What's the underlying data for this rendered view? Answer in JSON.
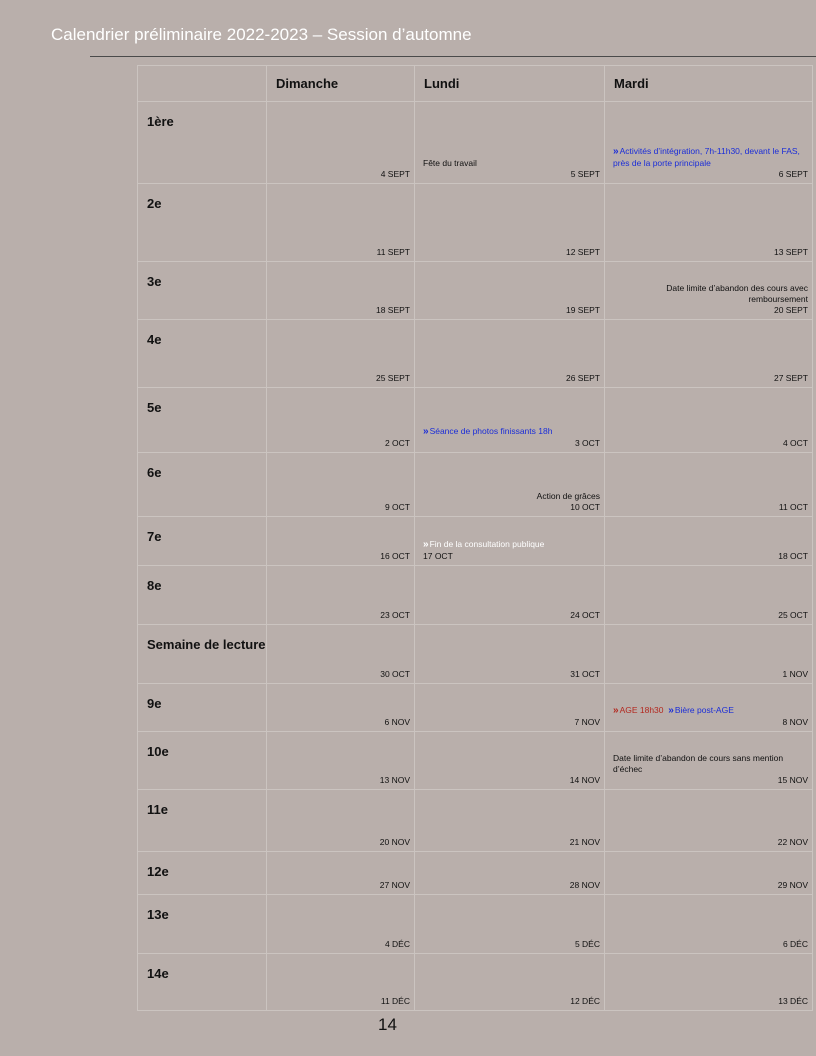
{
  "title": "Calendrier préliminaire 2022-2023 – Session d’automne",
  "headers": {
    "week": "",
    "sunday": "Dimanche",
    "monday": "Lundi",
    "tuesday": "Mardi"
  },
  "colors": {
    "background": "#b9afab",
    "blue": "#1a2dd8",
    "red": "#b3281f",
    "white": "#ffffff"
  },
  "arrow_icon": "»",
  "rows": [
    {
      "week": "1ère",
      "sun": "4 SEPT",
      "mon": "5 SEPT",
      "mon_note": "Fête du travail",
      "tue": "6 SEPT",
      "tue_note": "Activités d’intégration, 7h-11h30, devant le FAS, près de la porte principale"
    },
    {
      "week": "2e",
      "sun": "11 SEPT",
      "mon": "12 SEPT",
      "tue": "13 SEPT"
    },
    {
      "week": "3e",
      "sun": "18 SEPT",
      "mon": "19 SEPT",
      "tue": "20 SEPT",
      "tue_note": "Date limite d’abandon des cours avec remboursement"
    },
    {
      "week": "4e",
      "sun": "25 SEPT",
      "mon": "26 SEPT",
      "tue": "27 SEPT"
    },
    {
      "week": "5e",
      "sun": "2 OCT",
      "mon": "3 OCT",
      "mon_note": "Séance de photos finissants 18h",
      "tue": "4 OCT"
    },
    {
      "week": "6e",
      "sun": "9 OCT",
      "mon": "10 OCT",
      "mon_note": "Action de grâces",
      "tue": "11 OCT"
    },
    {
      "week": "7e",
      "sun": "16 OCT",
      "mon": "17 OCT",
      "mon_note": "Fin de la consultation publique",
      "tue": "18 OCT"
    },
    {
      "week": "8e",
      "sun": "23 OCT",
      "mon": "24 OCT",
      "tue": "25 OCT"
    },
    {
      "week": "Semaine de lecture",
      "sun": "30 OCT",
      "mon": "31 OCT",
      "tue": "1 NOV"
    },
    {
      "week": "9e",
      "sun": "6 NOV",
      "mon": "7 NOV",
      "tue": "8 NOV",
      "tue_note_a": "AGE 18h30",
      "tue_note_b": "Bière post-AGE"
    },
    {
      "week": "10e",
      "sun": "13 NOV",
      "mon": "14 NOV",
      "tue": "15 NOV",
      "tue_note": "Date limite d’abandon de cours sans mention d’échec"
    },
    {
      "week": "11e",
      "sun": "20 NOV",
      "mon": "21 NOV",
      "tue": "22 NOV"
    },
    {
      "week": "12e",
      "sun": "27 NOV",
      "mon": "28 NOV",
      "tue": "29 NOV"
    },
    {
      "week": "13e",
      "sun": "4 DÉC",
      "mon": "5 DÉC",
      "tue": "6 DÉC"
    },
    {
      "week": "14e",
      "sun": "11 DÉC",
      "mon": "12 DÉC",
      "tue": "13 DÉC"
    }
  ],
  "page_number": "14"
}
